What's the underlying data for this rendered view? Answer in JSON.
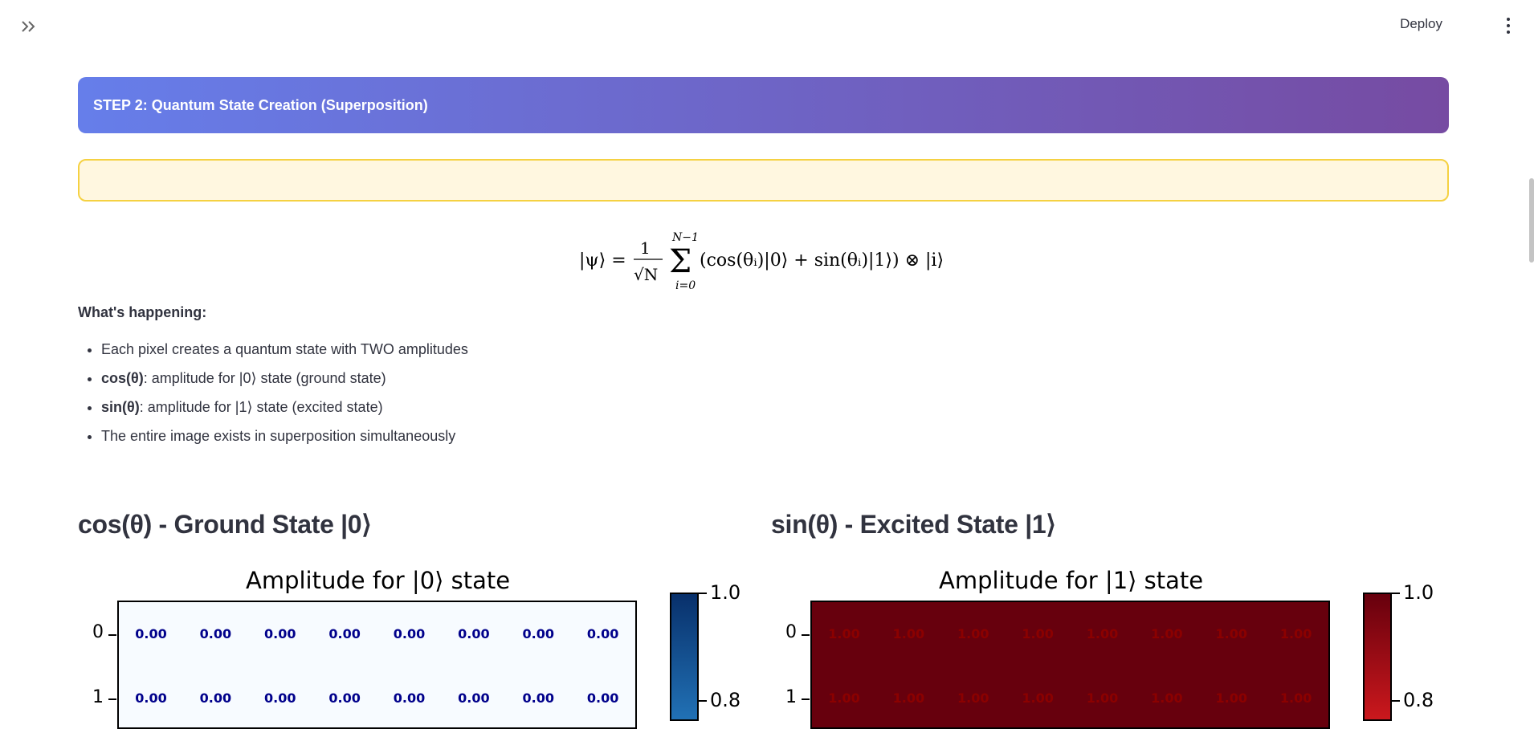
{
  "header": {
    "sidebar_toggle_icon": "double-chevron-right-icon",
    "deploy_label": "Deploy",
    "menu_icon": "vertical-ellipsis-icon"
  },
  "step_banner": {
    "title": "STEP 2: Quantum State Creation (Superposition)"
  },
  "alert": {
    "text": ""
  },
  "formula": {
    "latex": "|\\psi\\rangle = \\frac{1}{\\sqrt{N}} \\sum_{i=0}^{N-1} (\\cos(\\theta_i)|0\\rangle + \\sin(\\theta_i)|1\\rangle) \\otimes |i\\rangle"
  },
  "explanation": {
    "heading": "What's happening:",
    "bullets": [
      {
        "bold": "",
        "text": "Each pixel creates a quantum state with TWO amplitudes"
      },
      {
        "bold": "cos(θ)",
        "text": ": amplitude for |0⟩ state (ground state)"
      },
      {
        "bold": "sin(θ)",
        "text": ": amplitude for |1⟩ state (excited state)"
      },
      {
        "bold": "",
        "text": "The entire image exists in superposition simultaneously"
      }
    ]
  },
  "left_panel": {
    "heading": "cos(θ) - Ground State |0⟩",
    "plot_title": "Amplitude for |0⟩ state",
    "row_ticks": [
      "0",
      "1"
    ],
    "colorbar_ticks": [
      "1.0",
      "0.8"
    ],
    "cell_color": "#f7fbff",
    "text_color": "#00008b",
    "colormap": "Blues",
    "rows": [
      [
        "0.00",
        "0.00",
        "0.00",
        "0.00",
        "0.00",
        "0.00",
        "0.00",
        "0.00"
      ],
      [
        "0.00",
        "0.00",
        "0.00",
        "0.00",
        "0.00",
        "0.00",
        "0.00",
        "0.00"
      ]
    ]
  },
  "right_panel": {
    "heading": "sin(θ) - Excited State |1⟩",
    "plot_title": "Amplitude for |1⟩ state",
    "row_ticks": [
      "0",
      "1"
    ],
    "colorbar_ticks": [
      "1.0",
      "0.8"
    ],
    "cell_color": "#67000d",
    "text_color": "#8b0000",
    "colormap": "Reds",
    "rows": [
      [
        "1.00",
        "1.00",
        "1.00",
        "1.00",
        "1.00",
        "1.00",
        "1.00",
        "1.00"
      ],
      [
        "1.00",
        "1.00",
        "1.00",
        "1.00",
        "1.00",
        "1.00",
        "1.00",
        "1.00"
      ]
    ]
  }
}
